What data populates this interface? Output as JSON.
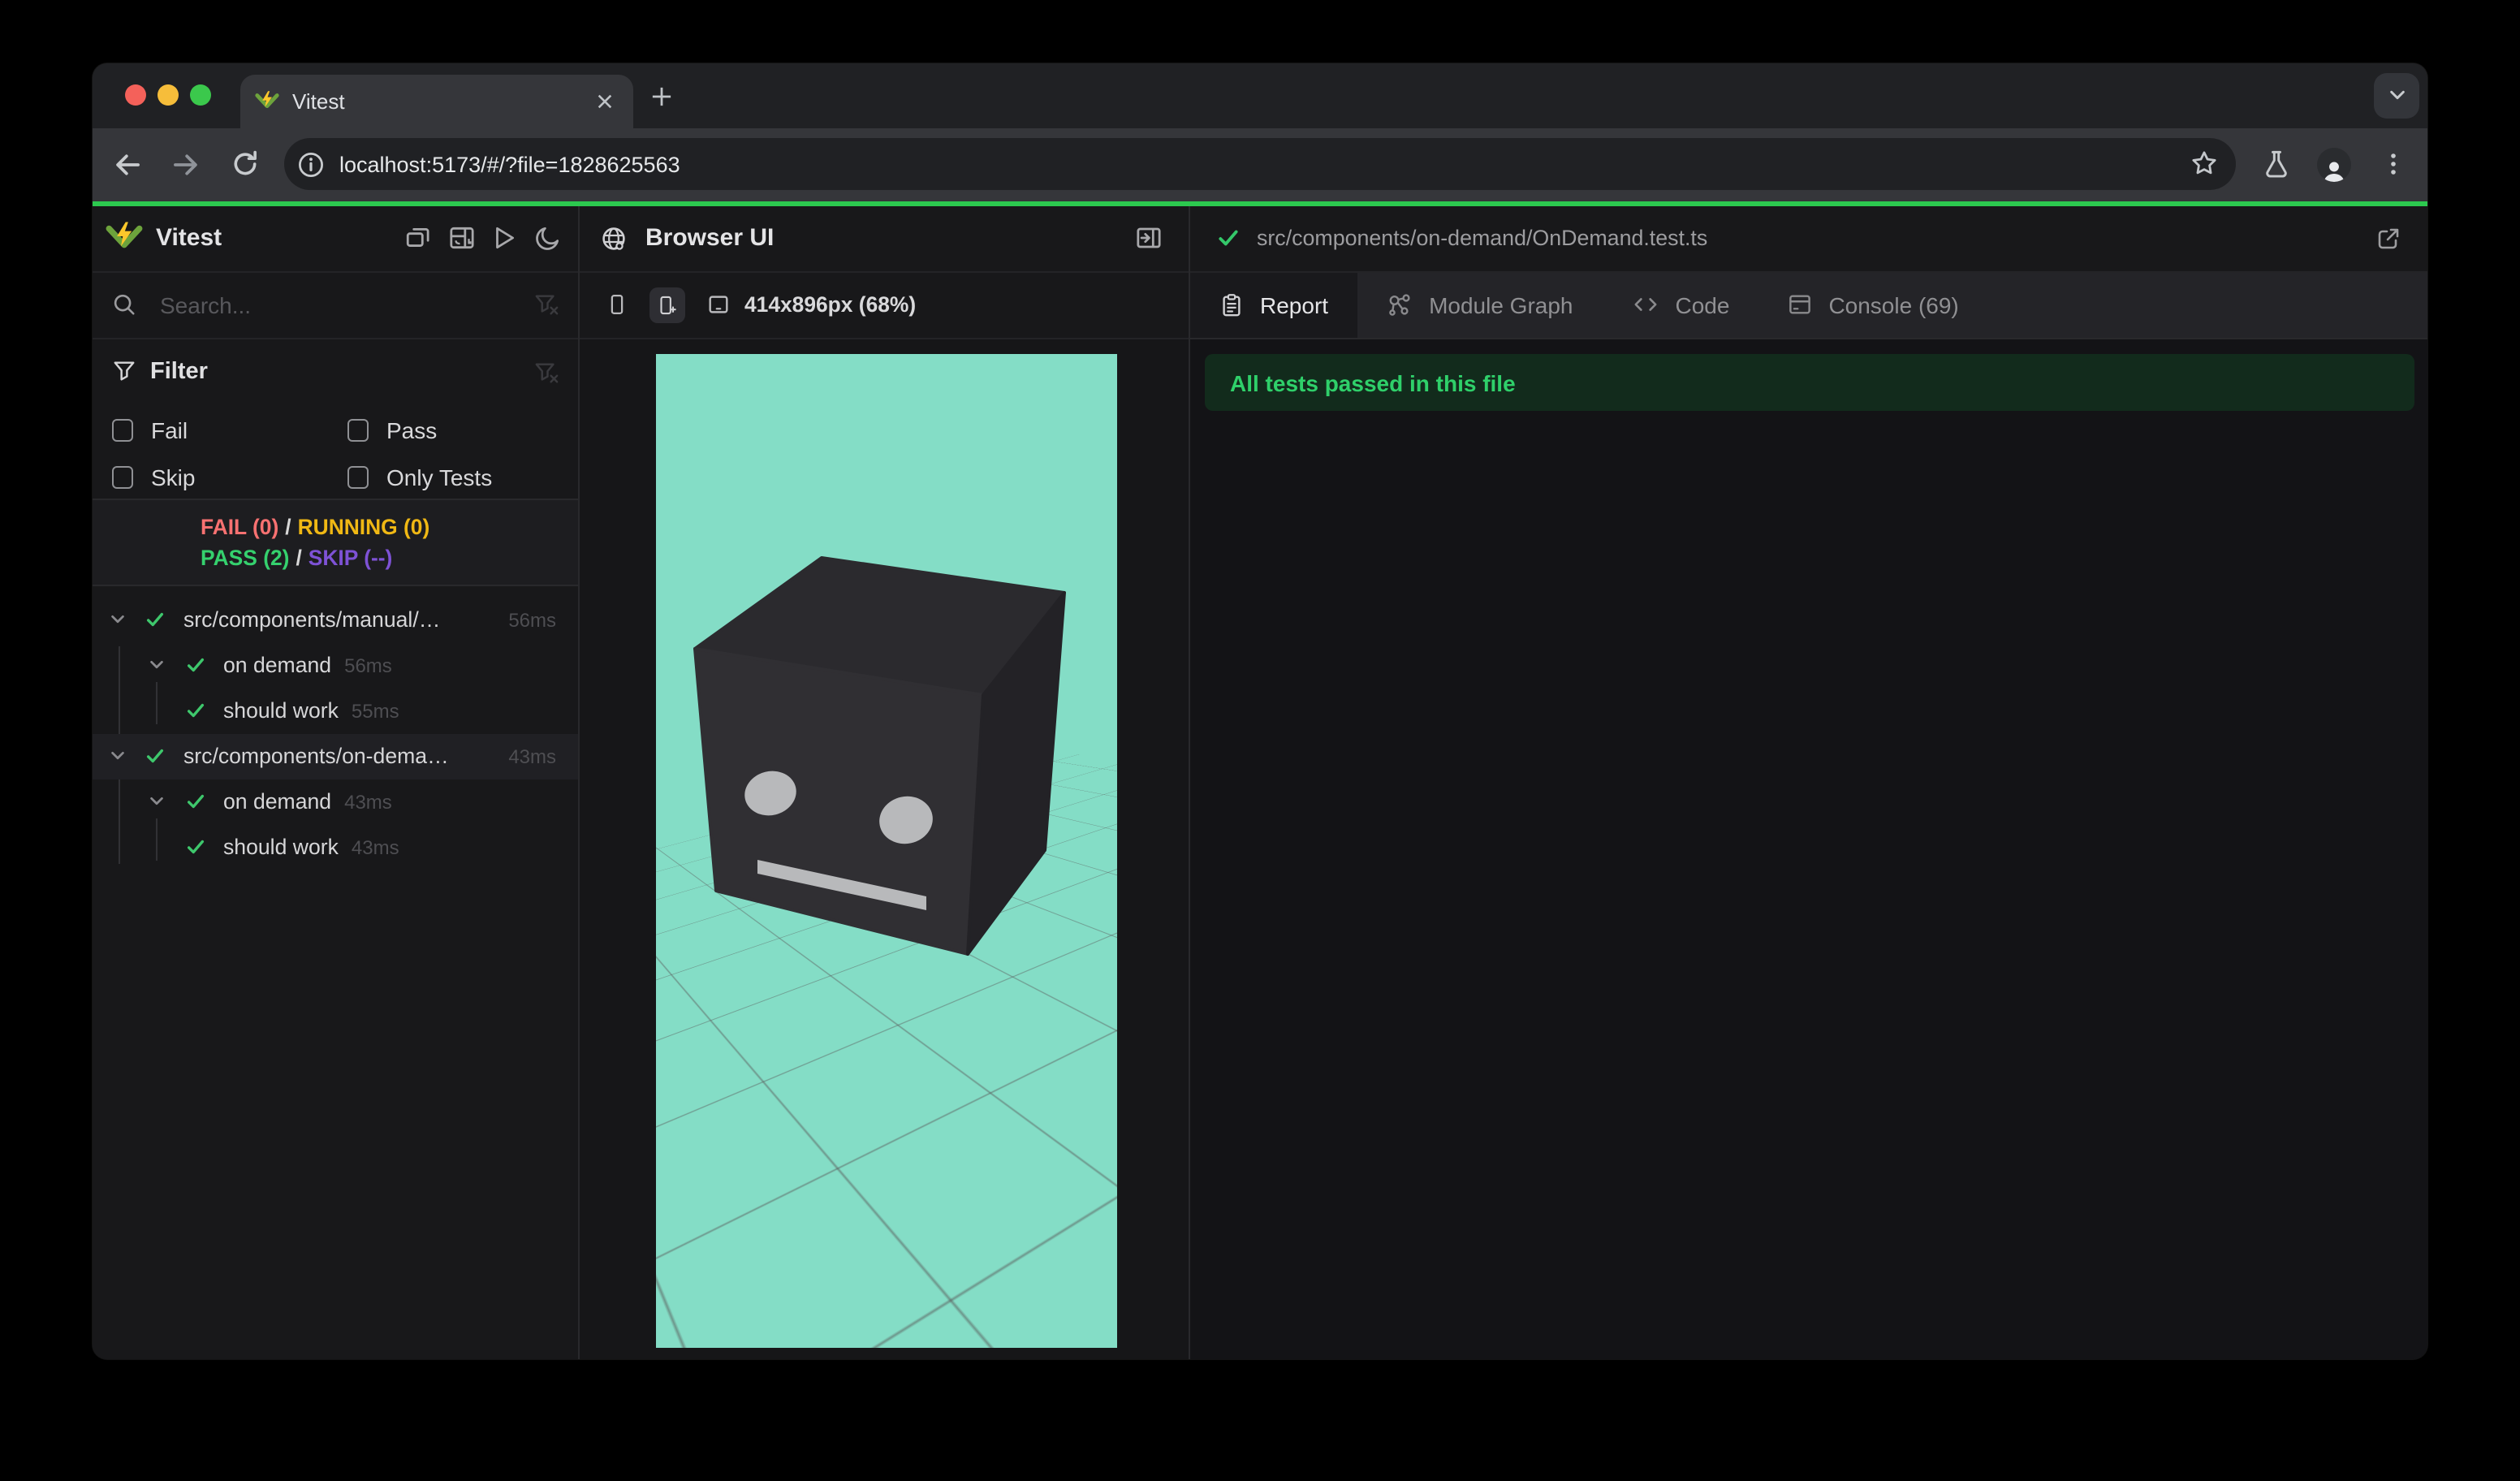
{
  "browser": {
    "tab_title": "Vitest",
    "url": "localhost:5173/#/?file=1828625563",
    "theme_accent_color": "#2cc94f"
  },
  "sidebar": {
    "app_title": "Vitest",
    "search_placeholder": "Search...",
    "filter_title": "Filter",
    "filters": [
      {
        "label": "Fail",
        "checked": false
      },
      {
        "label": "Pass",
        "checked": false
      },
      {
        "label": "Skip",
        "checked": false
      },
      {
        "label": "Only Tests",
        "checked": false
      }
    ],
    "summary": {
      "fail": "FAIL (0)",
      "running": "RUNNING (0)",
      "pass": "PASS (2)",
      "skip": "SKIP (--)",
      "separator": "/"
    },
    "tree": [
      {
        "name": "src/components/manual/…",
        "duration": "56ms",
        "level": 1,
        "kind": "file",
        "status": "pass",
        "expanded": true
      },
      {
        "name": "on demand",
        "duration": "56ms",
        "level": 2,
        "kind": "suite",
        "status": "pass",
        "expanded": true
      },
      {
        "name": "should work",
        "duration": "55ms",
        "level": 3,
        "kind": "test",
        "status": "pass"
      },
      {
        "name": "src/components/on-dema…",
        "duration": "43ms",
        "level": 1,
        "kind": "file",
        "status": "pass",
        "expanded": true,
        "selected": true
      },
      {
        "name": "on demand",
        "duration": "43ms",
        "level": 2,
        "kind": "suite",
        "status": "pass",
        "expanded": true
      },
      {
        "name": "should work",
        "duration": "43ms",
        "level": 3,
        "kind": "test",
        "status": "pass"
      }
    ]
  },
  "preview": {
    "panel_title": "Browser UI",
    "viewport_label": "414x896px (68%)",
    "scene": {
      "background": "#84ddc6",
      "object": "dark cube robot face on grid floor"
    }
  },
  "report": {
    "file_path": "src/components/on-demand/OnDemand.test.ts",
    "tabs": [
      "Report",
      "Module Graph",
      "Code",
      "Console (69)"
    ],
    "active_tab": "Report",
    "banner_text": "All tests passed in this file"
  },
  "colors": {
    "pass_green": "#35d16e",
    "fail_red": "#f87171",
    "running_yellow": "#f0b814",
    "skip_purple": "#7e52d6",
    "banner_bg": "#122b1c",
    "mint": "#84ddc6"
  },
  "icons": [
    "vitest-logo",
    "window-restore",
    "dashboard",
    "run-all",
    "dark-mode-moon",
    "search",
    "filter-funnel",
    "filter-clear",
    "globe",
    "open-panel-right",
    "phone",
    "phone-new",
    "tablet",
    "check",
    "chevron-down",
    "report-clipboard",
    "module-graph",
    "code-brackets",
    "console-panel",
    "external-link",
    "back-arrow",
    "forward-arrow",
    "reload",
    "info-circle",
    "bookmark-star",
    "flask",
    "profile",
    "menu-kebab",
    "tab-close",
    "new-tab-plus",
    "window-chevron"
  ]
}
